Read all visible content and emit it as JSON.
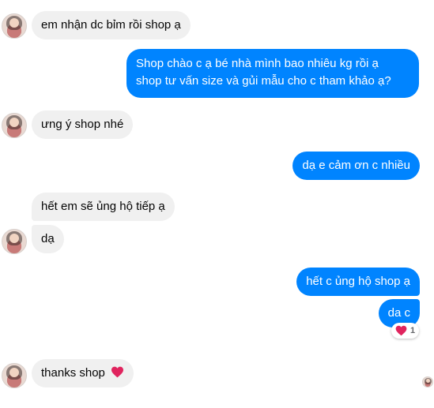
{
  "messages": [
    {
      "text": "em nhận dc bỉm rồi shop ạ"
    },
    {
      "line1": "Shop chào c ạ bé nhà mình bao nhiêu kg rồi ạ",
      "line2": "shop tư vấn size và gủi mẫu cho c tham khảo ạ?"
    },
    {
      "text": "ưng ý shop nhé"
    },
    {
      "text": "dạ e cảm ơn c nhiều"
    },
    {
      "text": "hết em sẽ ủng hộ tiếp ạ"
    },
    {
      "text": "dạ"
    },
    {
      "text": "hết c ủng hộ shop  ạ"
    },
    {
      "text": "da c",
      "reaction_icon": "heart-icon",
      "reaction_count": "1"
    },
    {
      "text": "thanks shop",
      "emoji": "heart-icon"
    }
  ],
  "colors": {
    "outgoing_bubble": "#0084ff",
    "incoming_bubble": "#f0f0f0",
    "heart": "#e0245e"
  }
}
